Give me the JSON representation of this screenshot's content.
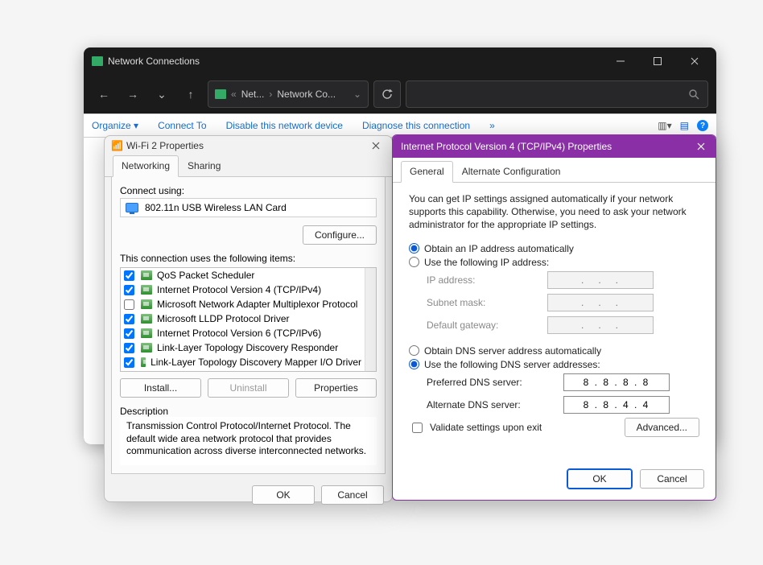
{
  "background_window": {
    "title": "Network Connections",
    "breadcrumb": {
      "c1": "Net...",
      "c2": "Network Co..."
    },
    "menubar": {
      "organize": "Organize ▾",
      "connect": "Connect To",
      "disable": "Disable this network device",
      "diagnose": "Diagnose this connection",
      "more": "»"
    }
  },
  "wifi": {
    "title": "Wi-Fi 2 Properties",
    "tabs": {
      "networking": "Networking",
      "sharing": "Sharing"
    },
    "connect_label": "Connect using:",
    "device": "802.11n USB Wireless LAN Card",
    "configure": "Configure...",
    "items_label": "This connection uses the following items:",
    "items": [
      {
        "checked": true,
        "label": "QoS Packet Scheduler"
      },
      {
        "checked": true,
        "label": "Internet Protocol Version 4 (TCP/IPv4)"
      },
      {
        "checked": false,
        "label": "Microsoft Network Adapter Multiplexor Protocol"
      },
      {
        "checked": true,
        "label": "Microsoft LLDP Protocol Driver"
      },
      {
        "checked": true,
        "label": "Internet Protocol Version 6 (TCP/IPv6)"
      },
      {
        "checked": true,
        "label": "Link-Layer Topology Discovery Responder"
      },
      {
        "checked": true,
        "label": "Link-Layer Topology Discovery Mapper I/O Driver"
      }
    ],
    "install": "Install...",
    "uninstall": "Uninstall",
    "properties": "Properties",
    "description_label": "Description",
    "description_text": "Transmission Control Protocol/Internet Protocol. The default wide area network protocol that provides communication across diverse interconnected networks.",
    "ok": "OK",
    "cancel": "Cancel"
  },
  "ip": {
    "title": "Internet Protocol Version 4 (TCP/IPv4) Properties",
    "tabs": {
      "general": "General",
      "alt": "Alternate Configuration"
    },
    "description": "You can get IP settings assigned automatically if your network supports this capability. Otherwise, you need to ask your network administrator for the appropriate IP settings.",
    "obtain_ip": "Obtain an IP address automatically",
    "use_ip": "Use the following IP address:",
    "ip_address_label": "IP address:",
    "subnet_label": "Subnet mask:",
    "gateway_label": "Default gateway:",
    "obtain_dns": "Obtain DNS server address automatically",
    "use_dns": "Use the following DNS server addresses:",
    "pref_dns_label": "Preferred DNS server:",
    "alt_dns_label": "Alternate DNS server:",
    "pref_dns_value": "8 . 8 . 8 . 8",
    "alt_dns_value": "8 . 8 . 4 . 4",
    "ip_placeholder": ".   .   .",
    "validate": "Validate settings upon exit",
    "advanced": "Advanced...",
    "ok": "OK",
    "cancel": "Cancel"
  }
}
